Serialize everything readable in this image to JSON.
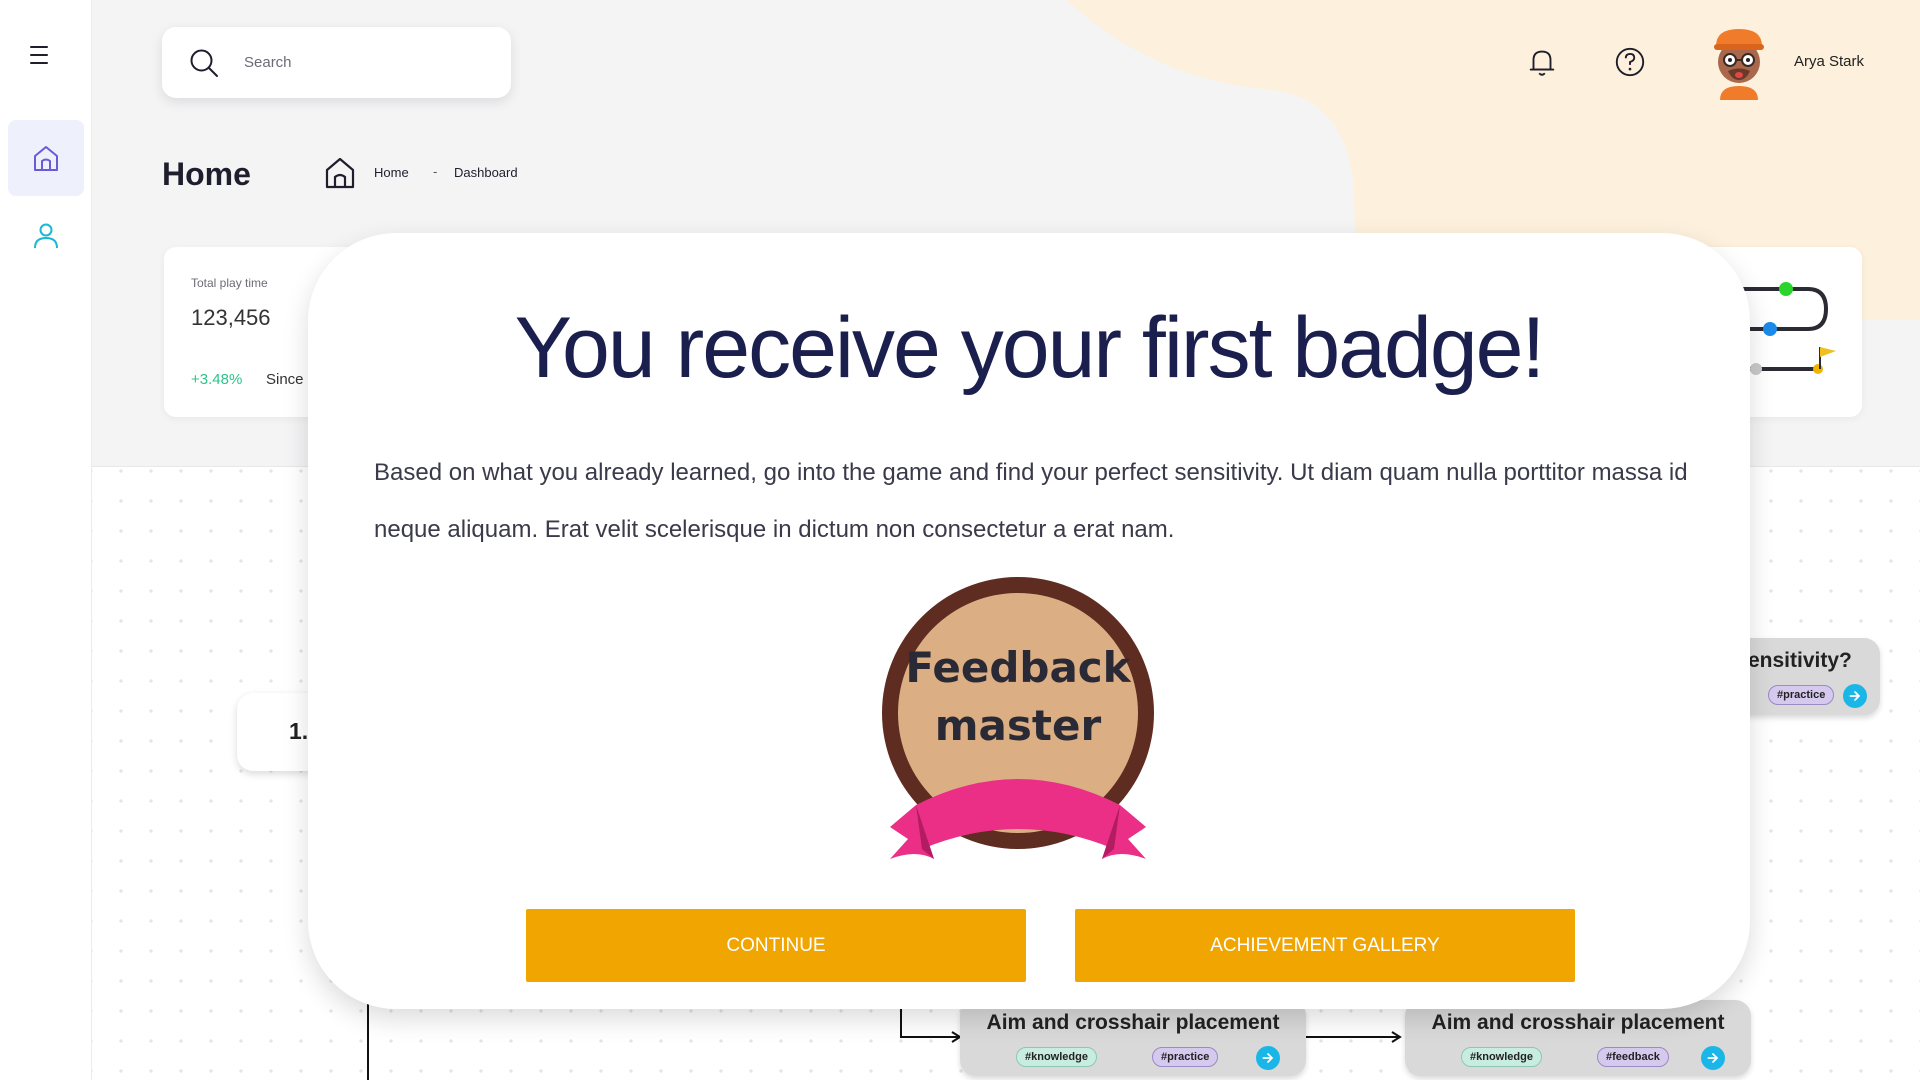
{
  "sidebar": {
    "menu_icon": "hamburger-icon",
    "items": [
      {
        "name": "home",
        "icon": "home-icon",
        "active": true
      },
      {
        "name": "profile",
        "icon": "user-icon",
        "active": false
      }
    ]
  },
  "header": {
    "search": {
      "placeholder": "Search",
      "icon": "search-icon"
    },
    "notification_icon": "bell-icon",
    "help_icon": "help-circle-icon",
    "user": {
      "name": "Arya Stark",
      "avatar": "avatar-icon"
    }
  },
  "page": {
    "title": "Home",
    "breadcrumb": {
      "home": "Home",
      "separator": "-",
      "current": "Dashboard"
    }
  },
  "stats": {
    "total_play_time": {
      "label": "Total play time",
      "value": "123,456",
      "change": "+3.48%",
      "since": "Since"
    }
  },
  "flow": {
    "step_label": "1.",
    "nodes": [
      {
        "title": "ensitivity?",
        "tags": [
          "#practice"
        ]
      },
      {
        "title": "Aim and crosshair placement",
        "tags": [
          "#knowledge",
          "#practice"
        ]
      },
      {
        "title": "Aim and crosshair placement",
        "tags": [
          "#knowledge",
          "#feedback"
        ]
      }
    ]
  },
  "modal": {
    "title": "You receive your first badge!",
    "body": "Based on what you already learned, go into the game and find your perfect sensitivity. Ut diam quam nulla porttitor massa  id neque aliquam.  Erat velit scelerisque in dictum non consectetur a erat nam.",
    "badge": {
      "line1": "Feedback",
      "line2": "master"
    },
    "buttons": {
      "continue": "CONTINUE",
      "gallery": "ACHIEVEMENT GALLERY"
    }
  },
  "colors": {
    "accent_button": "#f0a500",
    "title_navy": "#1a1f4e",
    "badge_fill": "#dcae84",
    "badge_ring": "#5e2c20",
    "ribbon": "#ec2f86",
    "positive": "#2bc48a",
    "header_blob": "#fdf0dc"
  }
}
